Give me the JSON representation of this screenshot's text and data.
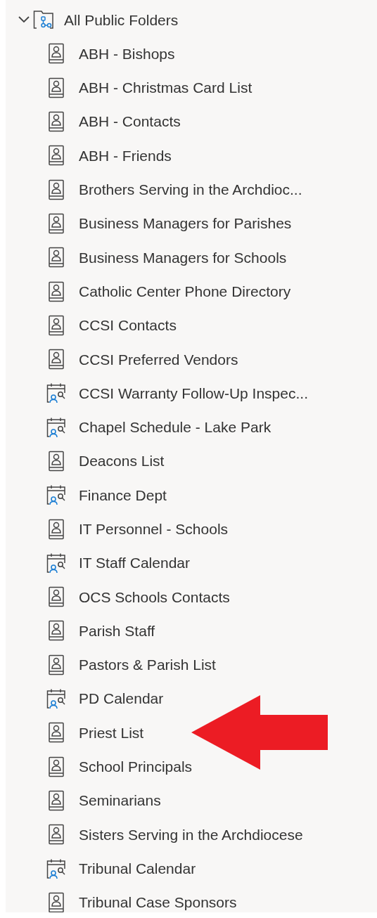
{
  "root": {
    "label": "All Public Folders",
    "expanded": true,
    "children": [
      {
        "label": "ABH - Bishops",
        "kind": "contacts"
      },
      {
        "label": "ABH - Christmas Card List",
        "kind": "contacts"
      },
      {
        "label": "ABH - Contacts",
        "kind": "contacts"
      },
      {
        "label": "ABH - Friends",
        "kind": "contacts"
      },
      {
        "label": "Brothers Serving in the Archdioc...",
        "kind": "contacts"
      },
      {
        "label": "Business Managers for Parishes",
        "kind": "contacts"
      },
      {
        "label": "Business Managers for Schools",
        "kind": "contacts"
      },
      {
        "label": "Catholic Center Phone Directory",
        "kind": "contacts"
      },
      {
        "label": "CCSI Contacts",
        "kind": "contacts"
      },
      {
        "label": "CCSI Preferred Vendors",
        "kind": "contacts"
      },
      {
        "label": "CCSI Warranty Follow-Up Inspec...",
        "kind": "calendar"
      },
      {
        "label": "Chapel Schedule - Lake Park",
        "kind": "calendar"
      },
      {
        "label": "Deacons List",
        "kind": "contacts"
      },
      {
        "label": "Finance Dept",
        "kind": "calendar"
      },
      {
        "label": "IT Personnel - Schools",
        "kind": "contacts"
      },
      {
        "label": "IT Staff Calendar",
        "kind": "calendar"
      },
      {
        "label": "OCS Schools Contacts",
        "kind": "contacts"
      },
      {
        "label": "Parish Staff",
        "kind": "contacts"
      },
      {
        "label": "Pastors & Parish List",
        "kind": "contacts"
      },
      {
        "label": "PD Calendar",
        "kind": "calendar"
      },
      {
        "label": "Priest List",
        "kind": "contacts",
        "pointed": true
      },
      {
        "label": "School Principals",
        "kind": "contacts"
      },
      {
        "label": "Seminarians",
        "kind": "contacts"
      },
      {
        "label": "Sisters Serving in the Archdiocese",
        "kind": "contacts"
      },
      {
        "label": "Tribunal Calendar",
        "kind": "calendar"
      },
      {
        "label": "Tribunal Case Sponsors",
        "kind": "contacts"
      }
    ]
  }
}
